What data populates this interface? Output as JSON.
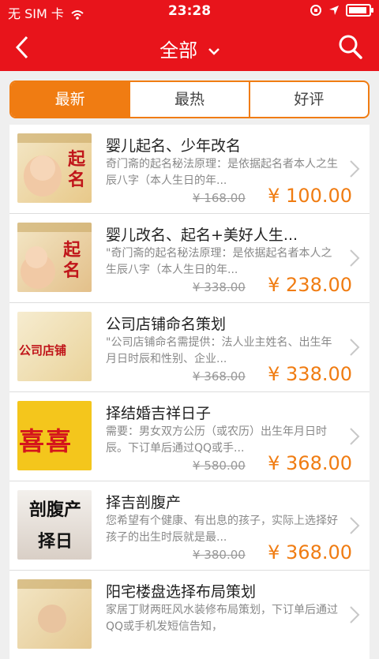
{
  "status": {
    "carrier": "无 SIM 卡",
    "time": "23:28"
  },
  "nav": {
    "title": "全部"
  },
  "tabs": [
    {
      "label": "最新",
      "active": true
    },
    {
      "label": "最热",
      "active": false
    },
    {
      "label": "好评",
      "active": false
    }
  ],
  "items": [
    {
      "title": "婴儿起名、少年改名",
      "desc": "奇门斋的起名秘法原理：是依据起名者本人之生辰八字（本人生日的年...",
      "old_price": "¥ 168.00",
      "price": "¥ 100.00",
      "thumb_text": "起名"
    },
    {
      "title": "婴儿改名、起名+美好人生...",
      "desc": "\"奇门斋的起名秘法原理：是依据起名者本人之生辰八字（本人生日的年...",
      "old_price": "¥ 338.00",
      "price": "¥ 238.00",
      "thumb_text": "起名"
    },
    {
      "title": "公司店铺命名策划",
      "desc": "\"公司店铺命名需提供：法人业主姓名、出生年月日时辰和性别、企业...",
      "old_price": "¥ 368.00",
      "price": "¥ 338.00",
      "thumb_text": "公司店铺"
    },
    {
      "title": "择结婚吉祥日子",
      "desc": "需要：男女双方公历（或农历）出生年月日时辰。下订单后通过QQ或手...",
      "old_price": "¥ 580.00",
      "price": "¥ 368.00",
      "thumb_text": "喜喜"
    },
    {
      "title": "择吉剖腹产",
      "desc": "您希望有个健康、有出息的孩子，实际上选择好孩子的出生时辰就是最...",
      "old_price": "¥ 380.00",
      "price": "¥ 368.00",
      "thumb_text": "剖腹产 择日"
    },
    {
      "title": "阳宅楼盘选择布局策划",
      "desc": "家居丁财两旺风水装修布局策划，下订单后通过QQ或手机发短信告知，",
      "old_price": "",
      "price": "",
      "thumb_text": ""
    }
  ],
  "colors": {
    "brand_red": "#e8141b",
    "accent_orange": "#f07c12"
  }
}
